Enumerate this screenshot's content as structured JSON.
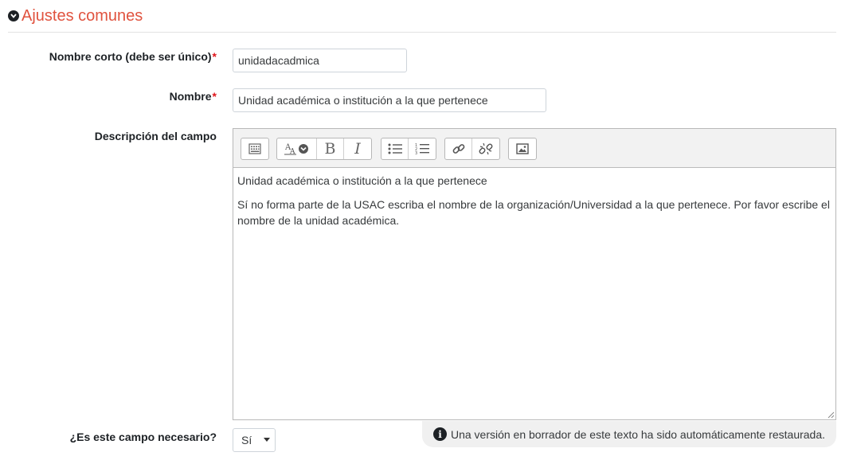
{
  "section": {
    "title": "Ajustes comunes",
    "icon": "chevron-down-circle-icon"
  },
  "fields": {
    "shortname": {
      "label": "Nombre corto (debe ser único)",
      "required_mark": "*",
      "value": "unidadacadmica"
    },
    "name": {
      "label": "Nombre",
      "required_mark": "*",
      "value": "Unidad académica o institución a la que pertenece"
    },
    "description": {
      "label": "Descripción del campo",
      "toolbar_icons": [
        "toolbar-toggle-icon",
        "font-style-icon",
        "bold-icon",
        "italic-icon",
        "unordered-list-icon",
        "ordered-list-icon",
        "link-icon",
        "unlink-icon",
        "image-icon"
      ],
      "bold_glyph": "B",
      "italic_glyph": "I",
      "paragraph_1": "Unidad académica o institución a la que pertenece",
      "paragraph_2": "Sí no forma parte de la USAC escriba el nombre de la organización/Universidad a la que pertenece. Por favor escribe el nombre de la unidad académica."
    },
    "required_field": {
      "label": "¿Es este campo necesario?",
      "selected": "Sí"
    }
  },
  "draft_notice": {
    "text": "Una versión en borrador de este texto ha sido automáticamente restaurada.",
    "icon_glyph": "i"
  },
  "colors": {
    "accent": "#e0533f",
    "required": "#e0171c"
  }
}
